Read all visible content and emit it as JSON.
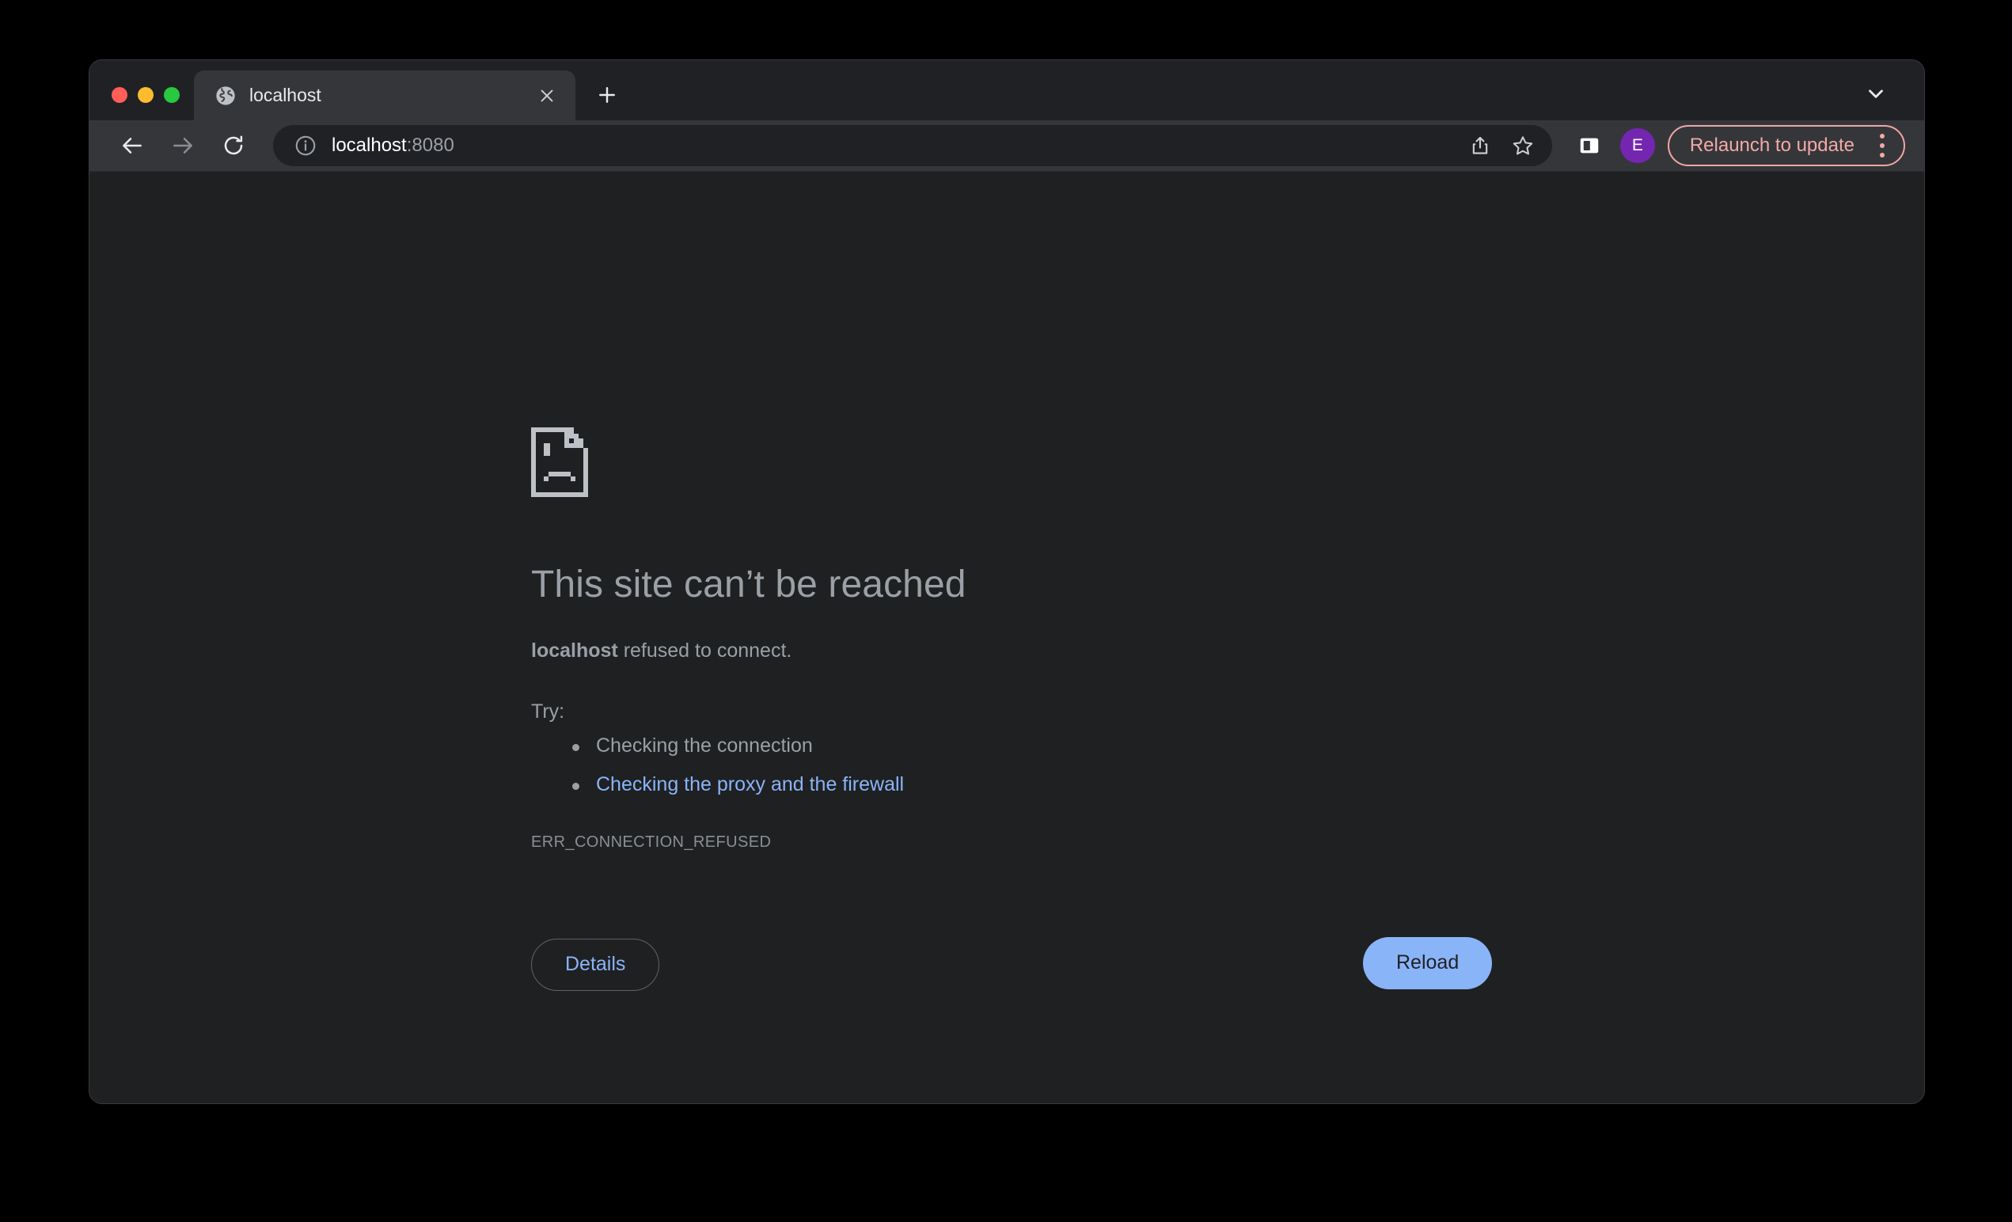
{
  "window": {
    "traffic_lights": [
      "close",
      "minimize",
      "zoom"
    ]
  },
  "tabs": {
    "active": {
      "title": "localhost",
      "favicon": "globe-icon",
      "close_icon": "close-icon"
    },
    "new_tab_icon": "plus-icon",
    "tab_search_icon": "chevron-down-icon"
  },
  "toolbar": {
    "back_icon": "arrow-left-icon",
    "forward_icon": "arrow-right-icon",
    "reload_icon": "reload-icon",
    "site_info_icon": "info-circle-icon",
    "url_host": "localhost",
    "url_port": ":8080",
    "url_full": "localhost:8080",
    "share_icon": "share-icon",
    "bookmark_icon": "star-icon",
    "side_panel_icon": "side-panel-icon",
    "avatar_initial": "E",
    "relaunch_label": "Relaunch to update",
    "menu_icon": "kebab-menu-icon"
  },
  "page": {
    "icon": "sad-page-icon",
    "title": "This site can’t be reached",
    "subject": "localhost",
    "subject_rest": " refused to connect.",
    "try_label": "Try:",
    "suggestions": [
      {
        "text": "Checking the connection",
        "is_link": false
      },
      {
        "text": "Checking the proxy and the firewall",
        "is_link": true
      }
    ],
    "error_code": "ERR_CONNECTION_REFUSED",
    "details_label": "Details",
    "reload_label": "Reload"
  },
  "colors": {
    "page_background": "#1f2022",
    "chrome_toolbar": "#35363a",
    "tab_strip": "#202124",
    "link_blue": "#8ab4f8",
    "text_gray": "#9aa0a6",
    "relaunch_pink": "#f2aaa7",
    "avatar_purple": "#7526b0"
  }
}
